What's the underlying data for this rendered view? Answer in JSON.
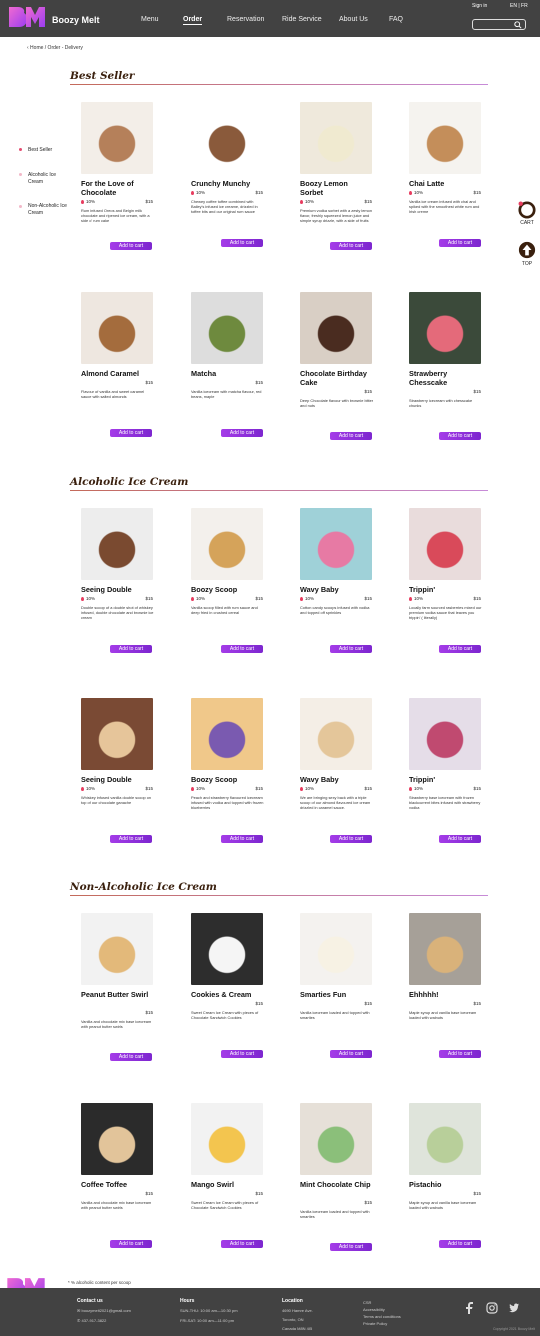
{
  "header": {
    "brand": "Boozy Melt",
    "nav": [
      "Menu",
      "Order",
      "Reservation",
      "Ride Service",
      "About Us",
      "FAQ"
    ],
    "sign_in": "Sign in",
    "lang": "EN | FR"
  },
  "breadcrumb": "‹ Home / Order - Delivery",
  "sidebar": [
    "Best Seller",
    "Alcoholic Ice Cream",
    "Non-Alcoholic Ice Cream"
  ],
  "cart_label": "CART",
  "top_label": "TOP",
  "add_label": "Add to cart",
  "sections": [
    {
      "title": "Best Seller",
      "rows": [
        [
          {
            "name": "For the Love of Chocolate",
            "alc": "10%",
            "price": "$15",
            "desc": "Rum infused Oreos and Belgin milk chocolate and ripened ice cream, with a side o' rum cake"
          },
          {
            "name": "Crunchy Munchy",
            "alc": "10%",
            "price": "$15",
            "desc": "Chewey coffee toffee combined with Bailey's infused ice creame, drizzled in toffee bits and our original rum sauce"
          },
          {
            "name": "Boozy Lemon Sorbet",
            "alc": "10%",
            "price": "$15",
            "desc": "Premium vodka sorbet with a zesty lemon flavor, freshly squeezed lemon juice and simple syrup drizzle, with a side of fruits"
          },
          {
            "name": "Chai Latte",
            "alc": "10%",
            "price": "$15",
            "desc": "Vanilla ice cream infused with chai and spiked with the smoothest white rum and Irish creme"
          }
        ],
        [
          {
            "name": "Almond Caramel",
            "alc": "",
            "price": "$15",
            "desc": "Flavour of vanilla and sweet caramel sauce with salted almonds"
          },
          {
            "name": "Matcha",
            "alc": "",
            "price": "$15",
            "desc": "Vanilla icecream with matcha flavour, red beans, maple"
          },
          {
            "name": "Chocolate Birthday Cake",
            "alc": "",
            "price": "$15",
            "desc": "Deep Chocolate flavour with brownie bitter and nuts"
          },
          {
            "name": "Strawberry Chesscake",
            "alc": "",
            "price": "$15",
            "desc": "Strawberry icecream with chesscake chunks"
          }
        ]
      ]
    },
    {
      "title": "Alcoholic Ice Cream",
      "rows": [
        [
          {
            "name": "Seeing Double",
            "alc": "10%",
            "price": "$15",
            "desc": "Double scoop of a double shot of whiskey infused, double chocolate and brownie ice cream"
          },
          {
            "name": "Boozy Scoop",
            "alc": "10%",
            "price": "$15",
            "desc": "Vanilla scoop filled with rum sauce and deep fried in crushed cereal"
          },
          {
            "name": "Wavy Baby",
            "alc": "10%",
            "price": "$15",
            "desc": "Cotton candy scoops infused with vodka and topped off sprinkles"
          },
          {
            "name": "Trippin'",
            "alc": "10%",
            "price": "$15",
            "desc": "Locally farm sourced rasberries mixed our premium vodka sauce that leaves you trippin' ( literally)"
          }
        ],
        [
          {
            "name": "Seeing Double",
            "alc": "10%",
            "price": "$15",
            "desc": "Whiskey infused vanilla double scoop on top of our chocolate ganache"
          },
          {
            "name": "Boozy Scoop",
            "alc": "10%",
            "price": "$15",
            "desc": "Peach and strawberry flavoured icecream infused with vodka and topped with frozen blueberries"
          },
          {
            "name": "Wavy Baby",
            "alc": "10%",
            "price": "$15",
            "desc": "We are bringing sexy back with a triple scoop of our almond flavoured ice cream drizzled in caramel sauce."
          },
          {
            "name": "Trippin'",
            "alc": "10%",
            "price": "$15",
            "desc": "Strawberry base icecream with frozen blackcurrent bites infused with strawberry vodka"
          }
        ]
      ]
    },
    {
      "title": "Non-Alcoholic Ice Cream",
      "rows": [
        [
          {
            "name": "Peanut Butter Swirl",
            "alc": "",
            "price": "$15",
            "desc": "Vanilla and chocolate mix base icecream with peanut butter swirls"
          },
          {
            "name": "Cookies & Cream",
            "alc": "",
            "price": "$15",
            "desc": "Sweet Cream Ice Cream with pieces of Chocolate Sandwich Cookies"
          },
          {
            "name": "Smarties Fun",
            "alc": "",
            "price": "$15",
            "desc": "Vanilla icecream loaded and topped with smarties"
          },
          {
            "name": "Ehhhhh!",
            "alc": "",
            "price": "$15",
            "desc": "Maple syrup and vanilla base icecream loaded with walnuts"
          }
        ],
        [
          {
            "name": "Coffee Toffee",
            "alc": "",
            "price": "$15",
            "desc": "Vanilla and chocolate mix base icecream with peanut butter swirls"
          },
          {
            "name": "Mango Swirl",
            "alc": "",
            "price": "$15",
            "desc": "Sweet Cream Ice Cream with pieces of Chocolate Sandwich Cookies"
          },
          {
            "name": "Mint Chocolate Chip",
            "alc": "",
            "price": "$15",
            "desc": "Vanilla icecream loaded and topped with smarties"
          },
          {
            "name": "Pistachio",
            "alc": "",
            "price": "$15",
            "desc": "Maple syrup and vanilla base icecream loaded with walnuts"
          }
        ]
      ]
    }
  ],
  "note": "* % alcoholic content per scoop",
  "footer": {
    "contact_title": "Contact us",
    "email": "boozymelt2021@gmail.com",
    "phone": "437-917-3822",
    "hours_title": "Hours",
    "hours1": "SUN-THU: 10:00 am—10:30 pm",
    "hours2": "FRI-SAT: 10:00 am—11:00 pm",
    "loc_title": "Location",
    "loc1": "4690 Hamre Ave.",
    "loc2": "Toronto, ON",
    "loc3": "Canada M8N 4I5",
    "links": [
      "CSR",
      "Accessibility",
      "Terms and conditions",
      "Private Policy"
    ],
    "copyright": "Copyright 2021 Boozy Melt"
  },
  "colors": {
    "header": "#424242",
    "accent": "#a43ce8",
    "title": "#3a200e",
    "brand_pink": "#e44bb0"
  }
}
